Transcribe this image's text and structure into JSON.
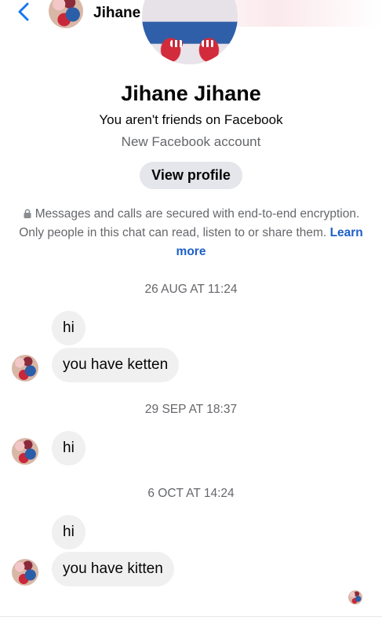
{
  "header": {
    "back_icon": "chevron-left-icon",
    "contact_name": "Jihane Jihane",
    "accent_color": "#1877f2"
  },
  "profile": {
    "name": "Jihane Jihane",
    "friend_status": "You aren't friends on Facebook",
    "account_note": "New Facebook account",
    "view_profile_label": "View profile"
  },
  "encryption": {
    "icon": "lock-icon",
    "text": "Messages and calls are secured with end-to-end encryption. Only people in this chat can read, listen to or share them.",
    "learn_more": "Learn more"
  },
  "conversation": [
    {
      "timestamp": "26 AUG AT 11:24",
      "messages": [
        "hi",
        "you have ketten"
      ]
    },
    {
      "timestamp": "29 SEP AT 18:37",
      "messages": [
        "hi"
      ]
    },
    {
      "timestamp": "6 OCT AT 14:24",
      "messages": [
        "hi",
        "you have kitten"
      ]
    }
  ],
  "colors": {
    "bubble_bg": "#f0f0f0",
    "secondary_text": "#65676b",
    "link": "#1d5fc9",
    "button_bg": "#e4e6eb"
  }
}
